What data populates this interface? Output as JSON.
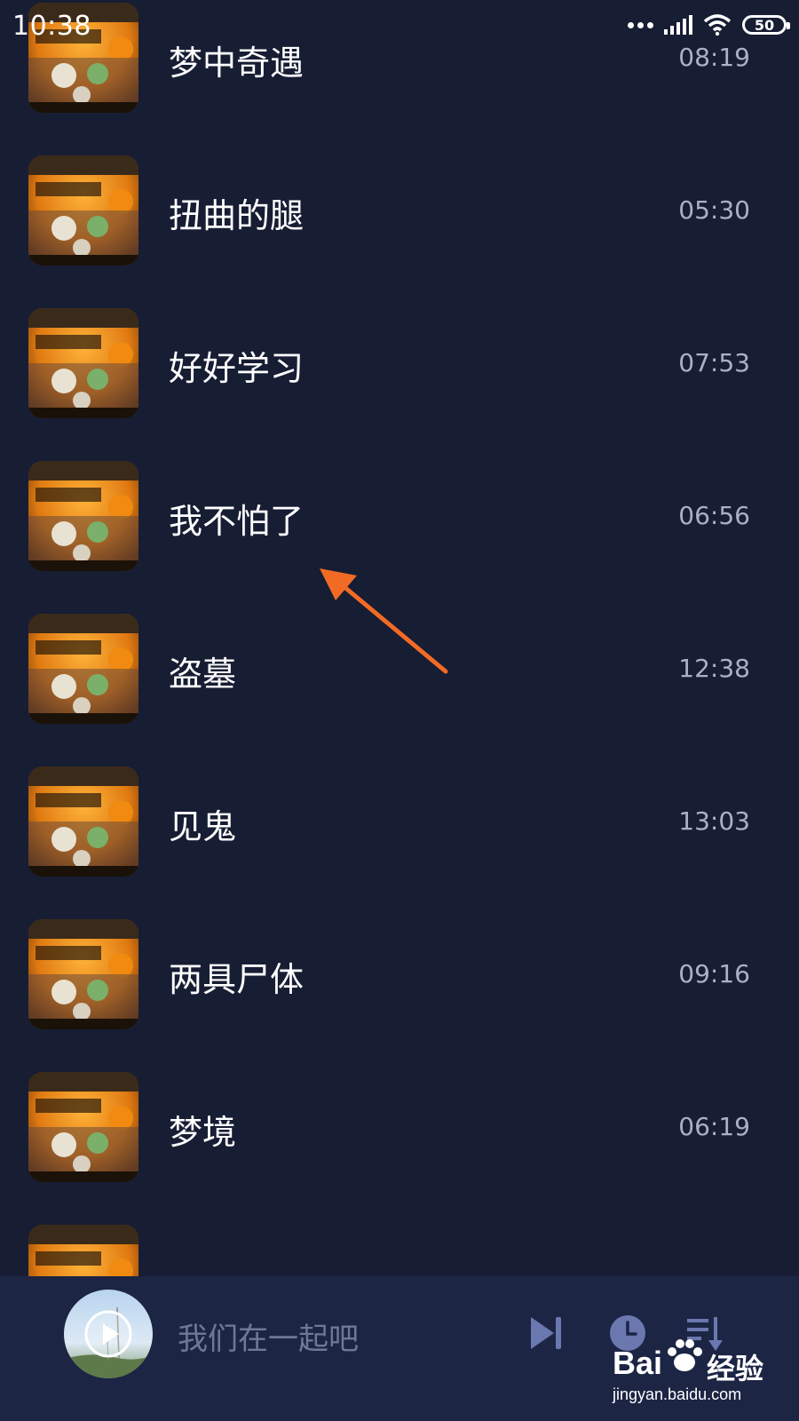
{
  "status_bar": {
    "time": "10:38",
    "battery_level": "50",
    "icons": [
      "more-dots-icon",
      "cellular-signal-icon",
      "wifi-icon",
      "battery-icon"
    ]
  },
  "songs": [
    {
      "title": "梦中奇遇",
      "duration": "08:19"
    },
    {
      "title": "扭曲的腿",
      "duration": "05:30"
    },
    {
      "title": "好好学习",
      "duration": "07:53"
    },
    {
      "title": "我不怕了",
      "duration": "06:56"
    },
    {
      "title": "盗墓",
      "duration": "12:38"
    },
    {
      "title": "见鬼",
      "duration": "13:03"
    },
    {
      "title": "两具尸体",
      "duration": "09:16"
    },
    {
      "title": "梦境",
      "duration": "06:19"
    },
    {
      "title": "",
      "duration": ""
    }
  ],
  "player": {
    "now_playing": "我们在一起吧",
    "controls": [
      "play-icon",
      "next-track-icon",
      "timer-clock-icon",
      "playlist-icon"
    ]
  },
  "watermark": {
    "brand_a": "Bai",
    "brand_b": "经验",
    "site": "jingyan.baidu.com"
  },
  "colors": {
    "background": "#171d33",
    "player_bar": "#1c2544",
    "control": "#6b78b0",
    "arrow": "#f26b24",
    "duration_text": "#aab1c4"
  }
}
